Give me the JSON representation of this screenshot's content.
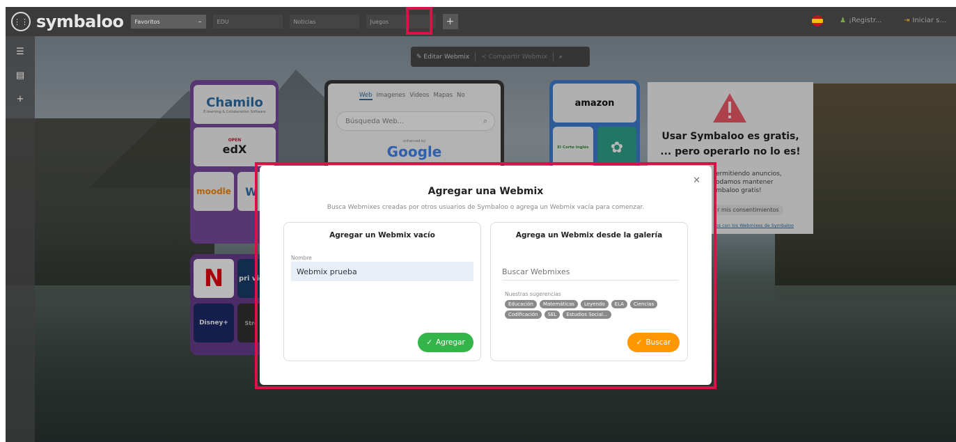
{
  "header": {
    "logo": "symbaloo",
    "tabs": [
      {
        "label": "Favoritos",
        "active": true
      },
      {
        "label": "EDU",
        "active": false
      },
      {
        "label": "Noticias",
        "active": false
      },
      {
        "label": "Juegos",
        "active": false
      }
    ],
    "active_tab_icon": "minus-icon",
    "add_tab_icon": "+",
    "register_label": "¡Registr...",
    "login_label": "Iniciar s..."
  },
  "webmix_toolbar": {
    "edit_label": "Editar Webmix",
    "share_label": "Compartir Webmix"
  },
  "tiles": {
    "chamilo": "Chamilo",
    "chamilo_sub": "E-learning & Collaboration Software",
    "openedx": "edX",
    "openedx_top": "OPEN",
    "moodle": "moodle",
    "amazon": "amazon",
    "elcorte": "El Corte Inglés",
    "netflix": "N",
    "prime": "pri vid",
    "disney": "Disney+",
    "w_tile": "W",
    "str_tile": "Stre"
  },
  "search_widget": {
    "tabs": [
      "Web",
      "Imagenes",
      "Videos",
      "Mapas",
      "No"
    ],
    "placeholder": "Búsqueda Web...",
    "powered_by": "enhanced by",
    "engine": "Google"
  },
  "ad": {
    "line1": "Usar Symbaloo es gratis,",
    "line2": "... pero operarlo no lo es!",
    "line3": "ermitiendo anuncios,",
    "line4": "odamos mantener",
    "line5": "mbaloo gratis!",
    "button": "r mis consentimientos",
    "link": "ios con los Webmixes de Symbaloo"
  },
  "modal": {
    "title": "Agregar una Webmix",
    "subtitle": "Busca Webmixes creadas por otros usuarios de Symbaloo o agrega un Webmix vacía para comenzar.",
    "left": {
      "heading": "Agregar un Webmix vacío",
      "name_label": "Nombre",
      "name_value": "Webmix prueba",
      "button": "Agregar"
    },
    "right": {
      "heading": "Agrega un Webmix desde la galería",
      "search_placeholder": "Buscar Webmixes",
      "suggestions_label": "Nuestras sugerencias",
      "suggestions": [
        "Educación",
        "Matemáticas",
        "Leyendo",
        "ELA",
        "Ciencias",
        "Codificación",
        "SEL",
        "Estudios Social..."
      ],
      "button": "Buscar"
    }
  },
  "colors": {
    "highlight": "#d6144a",
    "green": "#34b54a",
    "orange": "#ff9800",
    "chamilo_group": "#6a3d8e",
    "amazon_group": "#3f7fd1"
  }
}
